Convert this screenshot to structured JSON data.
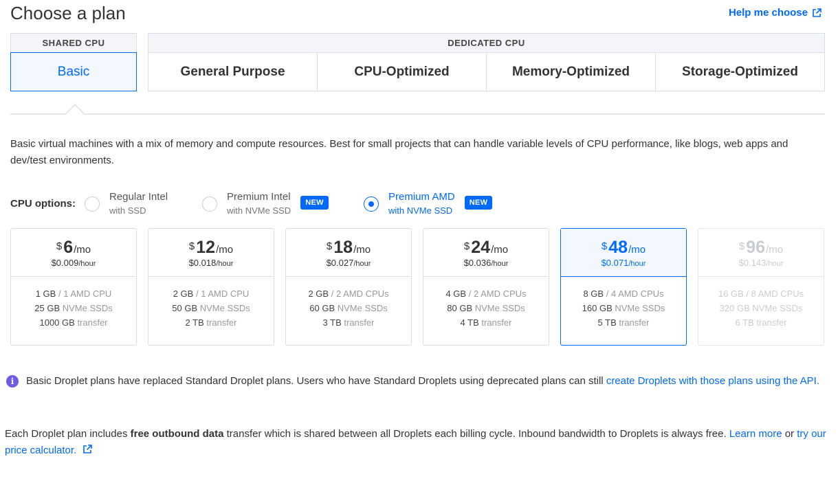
{
  "page": {
    "title": "Choose a plan",
    "help_link": "Help me choose"
  },
  "tabs": {
    "shared_header": "SHARED CPU",
    "shared": [
      "Basic"
    ],
    "dedicated_header": "DEDICATED CPU",
    "dedicated": [
      "General Purpose",
      "CPU-Optimized",
      "Memory-Optimized",
      "Storage-Optimized"
    ],
    "active": "Basic"
  },
  "description": "Basic virtual machines with a mix of memory and compute resources. Best for small projects that can handle variable levels of CPU performance, like blogs, web apps and dev/test environments.",
  "cpu_options": {
    "label": "CPU options:",
    "options": [
      {
        "main": "Regular Intel",
        "sub": "with SSD",
        "badge": "",
        "selected": false
      },
      {
        "main": "Premium Intel",
        "sub": "with NVMe SSD",
        "badge": "NEW",
        "selected": false
      },
      {
        "main": "Premium AMD",
        "sub": "with NVMe SSD",
        "badge": "NEW",
        "selected": true
      }
    ]
  },
  "plans": [
    {
      "currency": "$",
      "price": "6",
      "per": "/mo",
      "hourly": "$0.009",
      "hourly_unit": "/hour",
      "mem": "1 GB",
      "cpu": "/ 1 AMD CPU",
      "disk": "25 GB",
      "disk_label": "NVMe SSDs",
      "transfer": "1000 GB",
      "transfer_label": "transfer"
    },
    {
      "currency": "$",
      "price": "12",
      "per": "/mo",
      "hourly": "$0.018",
      "hourly_unit": "/hour",
      "mem": "2 GB",
      "cpu": "/ 1 AMD CPU",
      "disk": "50 GB",
      "disk_label": "NVMe SSDs",
      "transfer": "2 TB",
      "transfer_label": "transfer"
    },
    {
      "currency": "$",
      "price": "18",
      "per": "/mo",
      "hourly": "$0.027",
      "hourly_unit": "/hour",
      "mem": "2 GB",
      "cpu": "/ 2 AMD CPUs",
      "disk": "60 GB",
      "disk_label": "NVMe SSDs",
      "transfer": "3 TB",
      "transfer_label": "transfer"
    },
    {
      "currency": "$",
      "price": "24",
      "per": "/mo",
      "hourly": "$0.036",
      "hourly_unit": "/hour",
      "mem": "4 GB",
      "cpu": "/ 2 AMD CPUs",
      "disk": "80 GB",
      "disk_label": "NVMe SSDs",
      "transfer": "4 TB",
      "transfer_label": "transfer"
    },
    {
      "currency": "$",
      "price": "48",
      "per": "/mo",
      "hourly": "$0.071",
      "hourly_unit": "/hour",
      "mem": "8 GB",
      "cpu": "/ 4 AMD CPUs",
      "disk": "160 GB",
      "disk_label": "NVMe SSDs",
      "transfer": "5 TB",
      "transfer_label": "transfer"
    },
    {
      "currency": "$",
      "price": "96",
      "per": "/mo",
      "hourly": "$0.143",
      "hourly_unit": "/hour",
      "mem": "16 GB",
      "cpu": "/ 8 AMD CPUs",
      "disk": "320 GB",
      "disk_label": "NVMe SSDs",
      "transfer": "6 TB",
      "transfer_label": "transfer"
    }
  ],
  "notice": {
    "text": "Basic Droplet plans have replaced Standard Droplet plans. Users who have Standard Droplets using deprecated plans can still ",
    "link": "create Droplets with those plans using the API."
  },
  "footer": {
    "part1": "Each Droplet plan includes ",
    "bold": "free outbound data",
    "part2": " transfer which is shared between all Droplets each billing cycle. Inbound bandwidth to Droplets is always free. ",
    "link1": "Learn more",
    "part3": " or ",
    "link2": "try our price calculator."
  },
  "colors": {
    "accent": "#0069ff",
    "info": "#6c5ce7"
  }
}
